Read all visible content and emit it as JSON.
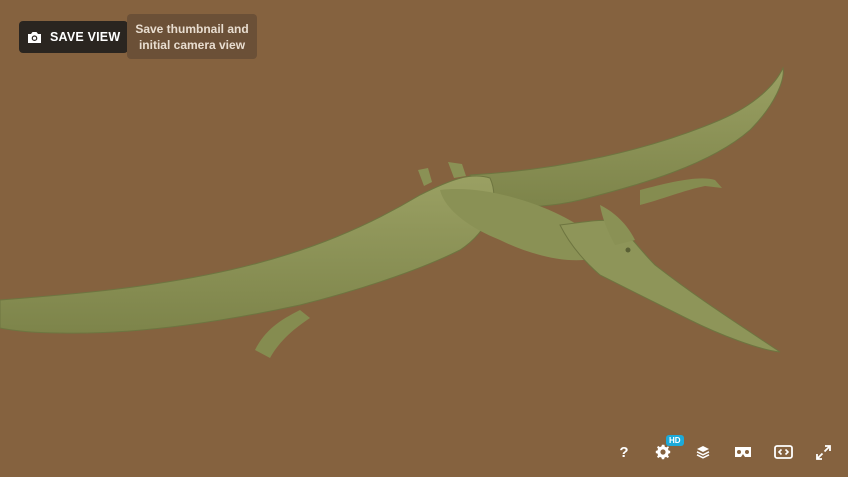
{
  "save_view": {
    "label": "SAVE VIEW",
    "icon": "camera-icon"
  },
  "tooltip": {
    "line1": "Save thumbnail and",
    "line2": "initial camera view"
  },
  "toolbar": {
    "help_label": "?",
    "hd_badge": "HD",
    "icons": [
      "help-icon",
      "settings-icon",
      "layers-icon",
      "vr-icon",
      "embed-icon",
      "fullscreen-icon"
    ]
  },
  "colors": {
    "background": "#85623f",
    "model": "#8e9559",
    "button_bg": "#2a2520",
    "tooltip_bg": "#6b5037",
    "hd_badge": "#1caad9"
  }
}
